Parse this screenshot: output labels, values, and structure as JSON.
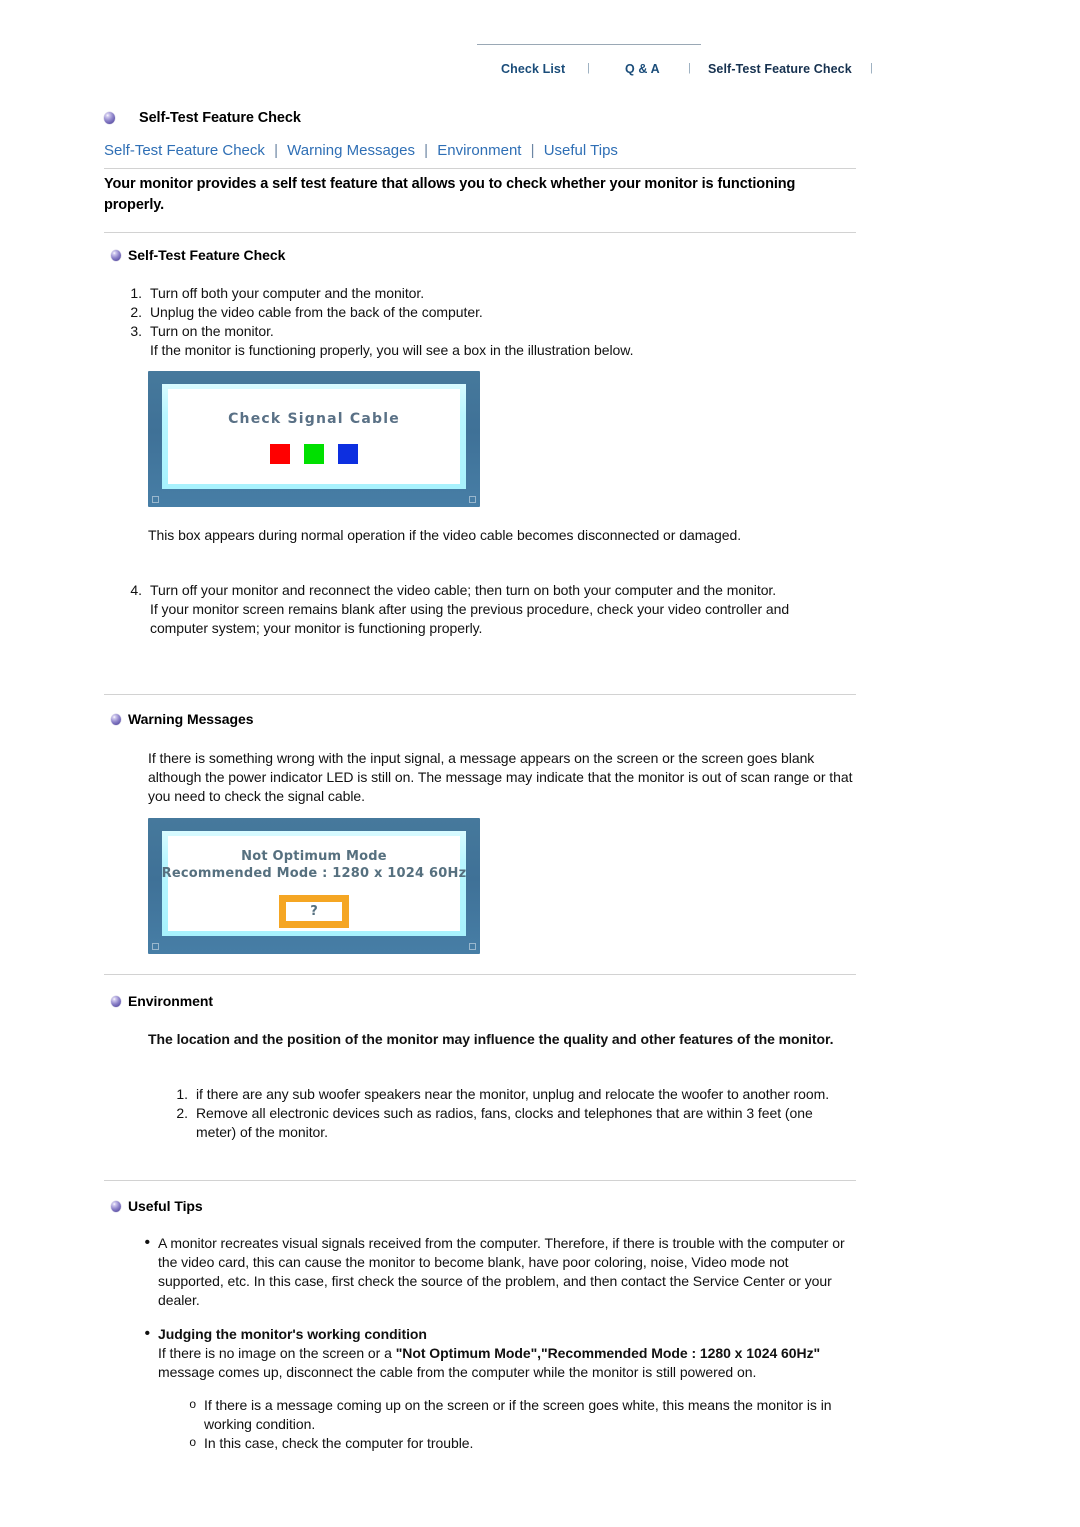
{
  "topnav": {
    "items": [
      {
        "label": "Check List",
        "active": false
      },
      {
        "label": "Q & A",
        "active": false
      },
      {
        "label": "Self-Test Feature Check",
        "active": true
      }
    ],
    "separator": "|",
    "active_bar_color": "#9b1020",
    "link_color": "#1b4d7a"
  },
  "page": {
    "title": "Self-Test Feature Check",
    "bullet_icon": "violet-sphere-bullet-icon",
    "subnav": {
      "items": [
        "Self-Test Feature Check",
        "Warning Messages",
        "Environment",
        "Useful Tips"
      ],
      "separator": "|",
      "link_color": "#2f6fb5"
    },
    "lead": "Your monitor provides a self test feature that allows you to check whether your monitor is functioning properly."
  },
  "sections": {
    "self_test": {
      "heading": "Self-Test Feature Check",
      "steps": [
        {
          "num": "1.",
          "text": "Turn off both your computer and the monitor."
        },
        {
          "num": "2.",
          "text": "Unplug the video cable from the back of the computer."
        },
        {
          "num": "3.",
          "text": "Turn on the monitor.",
          "extra": "If the monitor is functioning properly, you will see a box in the illustration below."
        }
      ],
      "after_image": "This box appears during normal operation if the video cable becomes disconnected or damaged.",
      "step4": {
        "num": "4.",
        "text": "Turn off your monitor and reconnect the video cable; then turn on both your computer and the monitor.",
        "extra": "If your monitor screen remains blank after using the previous procedure, check your video controller and computer system; your monitor is functioning properly."
      }
    },
    "warning": {
      "heading": "Warning Messages",
      "paragraph": "If there is something wrong with the input signal, a message appears on the screen or the screen goes blank although the power indicator LED is still on. The message may indicate that the monitor is out of scan range or that you need to check the signal cable."
    },
    "environment": {
      "heading": "Environment",
      "lead": "The location and the position of the monitor may influence the quality and other features of the monitor.",
      "items": [
        {
          "num": "1.",
          "text": "if there are any sub woofer speakers near the monitor, unplug and relocate the woofer to another room."
        },
        {
          "num": "2.",
          "text": "Remove all electronic devices such as radios, fans, clocks and telephones that are within 3 feet (one meter) of the monitor."
        }
      ]
    },
    "useful_tips": {
      "heading": "Useful Tips",
      "bullet": "•",
      "tip": "A monitor recreates visual signals received from the computer. Therefore, if there is trouble with the computer or the video card, this can cause the monitor to become blank, have poor coloring, noise, Video mode not supported, etc. In this case, first check the source of the problem, and then contact the Service Center or your dealer.",
      "judging": {
        "title": "Judging the monitor's working condition",
        "text_part1": "If there is no image on the screen or a ",
        "text_bold1": "\"Not Optimum Mode\",\"Recommended Mode : 1280 x 1024 60Hz\"",
        "text_part2": " message comes up, disconnect the cable from the computer while the monitor is still powered on.",
        "sub_bullet": "o",
        "subitems": [
          "If there is a message coming up on the screen or if the screen goes white, this means the monitor is in working condition.",
          "In this case, check the computer for trouble."
        ]
      }
    }
  },
  "illustrations": {
    "check_signal_cable": {
      "message": "Check Signal Cable",
      "swatches": [
        "#ff0000",
        "#00e000",
        "#0d2fe0"
      ],
      "frame_color": "#43769c",
      "glow_color": "#b9f6ff"
    },
    "not_optimum_mode": {
      "line1": "Not Optimum Mode",
      "line2": "Recommended Mode : 1280 x 1024  60Hz",
      "question_mark": "?",
      "box_border_color": "#f5a623",
      "frame_color": "#43769c",
      "glow_color": "#b9f6ff"
    }
  }
}
